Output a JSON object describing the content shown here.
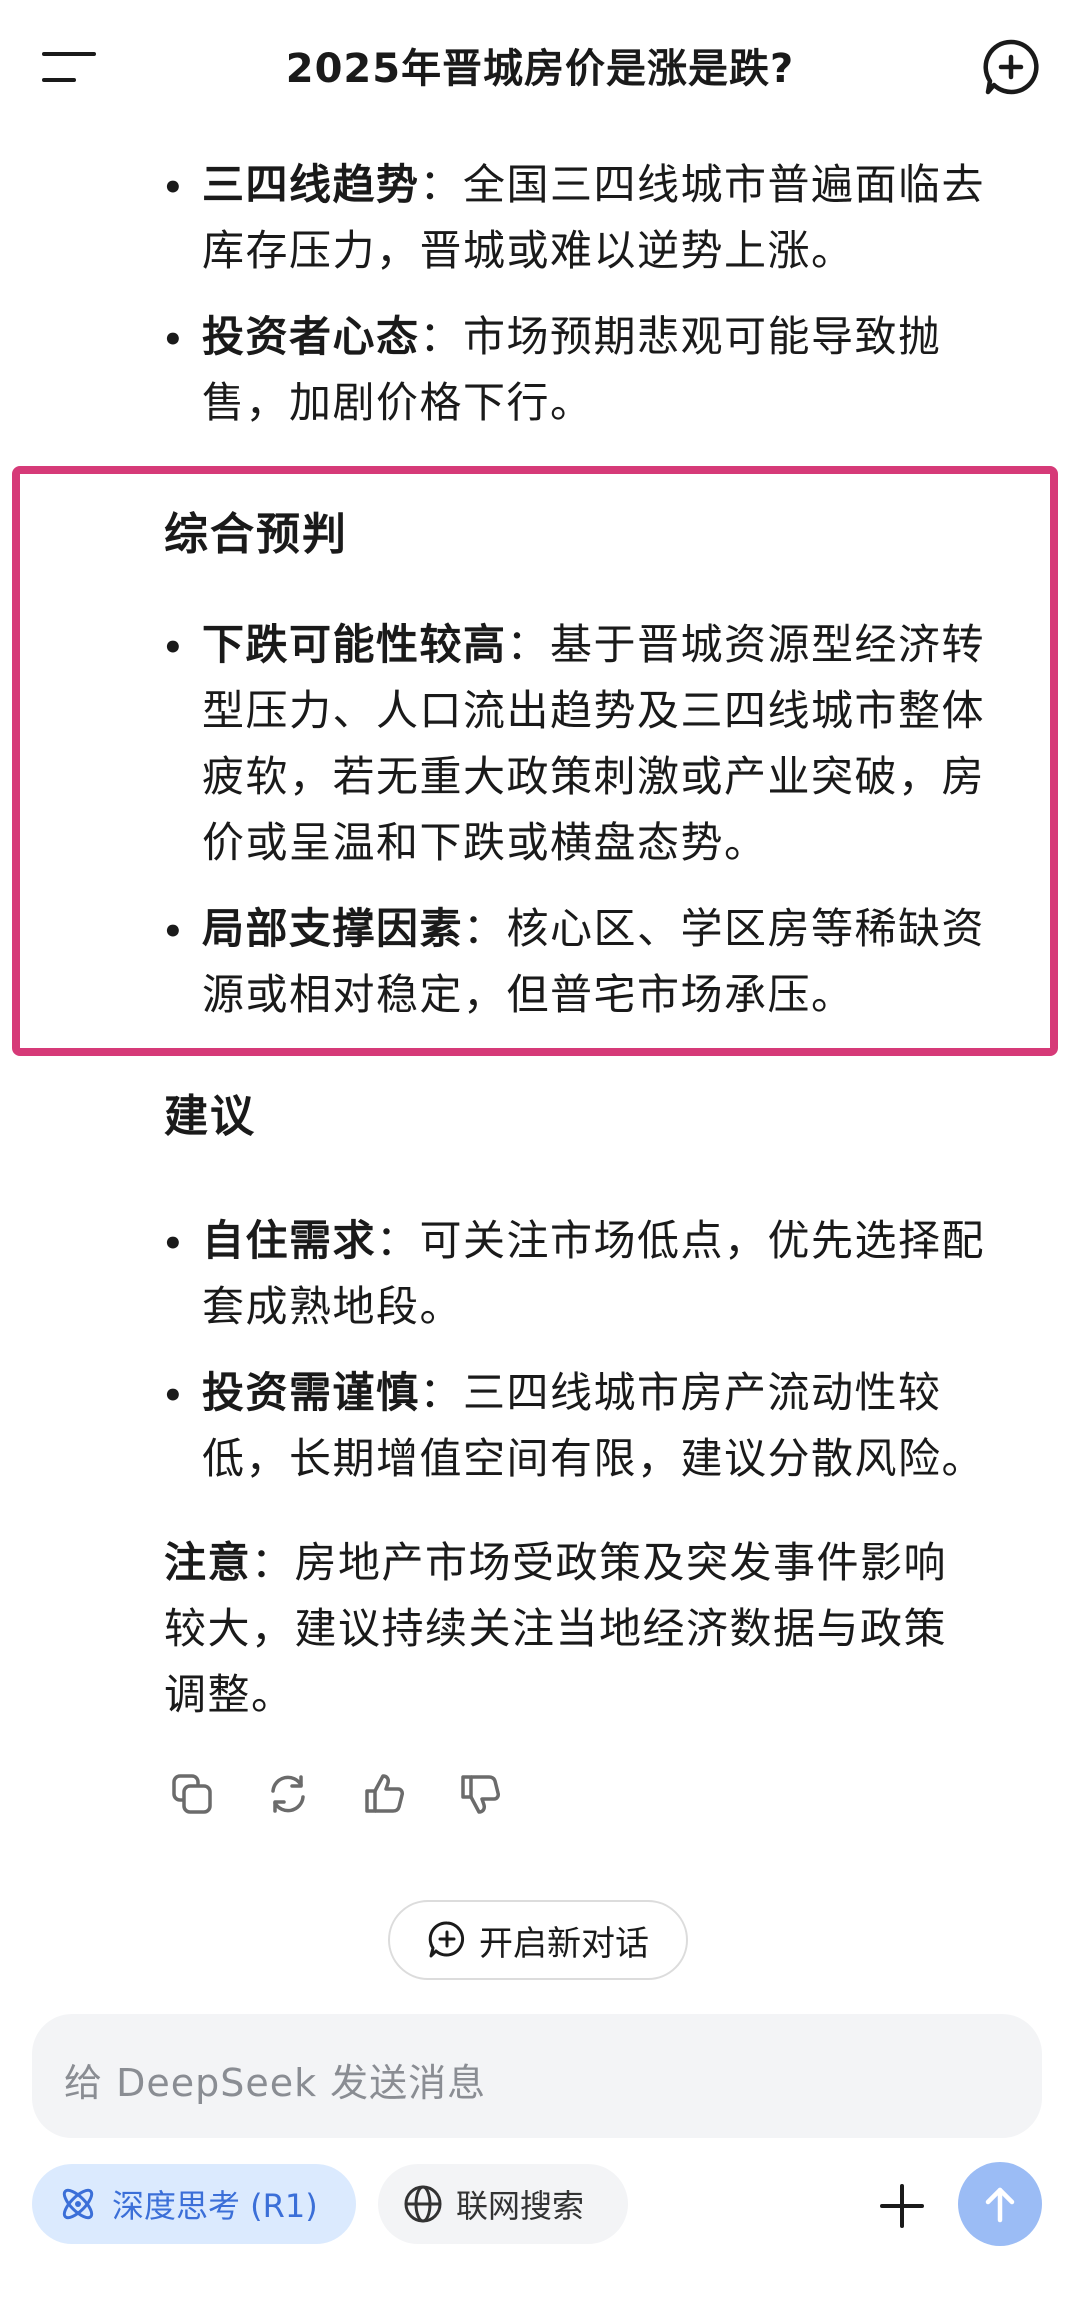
{
  "header": {
    "title": "2025年晋城房价是涨是跌?"
  },
  "sections": {
    "top": [
      {
        "term": "三四线趋势",
        "sep": ":",
        "text": "全国三四线城市普遍面临去库存压力，晋城或难以逆势上涨。",
        "lines": [
          "三四线趋势：全国三四线城市普遍面临去",
          "库存压力，晋城或难以逆势上涨。"
        ]
      },
      {
        "term": "投资者心态",
        "sep": ":",
        "text": "市场预期悲观可能导致抛售，加剧价格下行。",
        "lines": [
          "投资者心态：市场预期悲观可能导致抛",
          "售，加剧价格下行。"
        ]
      }
    ],
    "forecast": {
      "heading": "综合预判",
      "items": [
        {
          "term": "下跌可能性较高",
          "lines": [
            "：基于晋城资源型经济转",
            "型压力、人口流出趋势及三四线城市整体",
            "疲软，若无重大政策刺激或产业突破，房",
            "价或呈温和下跌或横盘态势。"
          ]
        },
        {
          "term": "局部支撑因素",
          "lines": [
            "：核心区、学区房等稀缺资",
            "源或相对稳定，但普宅市场承压。"
          ]
        }
      ]
    },
    "advice": {
      "heading": "建议",
      "items": [
        {
          "term": "自住需求",
          "lines": [
            "：可关注市场低点，优先选择配",
            "套成熟地段。"
          ]
        },
        {
          "term": "投资需谨慎",
          "lines": [
            "：三四线城市房产流动性较",
            "低，长期增值空间有限，建议分散风险。"
          ]
        }
      ]
    },
    "note": {
      "term": "注意",
      "lines": [
        "：房地产市场受政策及突发事件影响",
        "较大，建议持续关注当地经济数据与政策",
        "调整。"
      ]
    }
  },
  "actions": {
    "icons": [
      "copy-icon",
      "regenerate-icon",
      "thumbs-up-icon",
      "thumbs-down-icon"
    ]
  },
  "new_chat_label": "开启新对话",
  "composer": {
    "placeholder": "给 DeepSeek 发送消息",
    "deep_think_label": "深度思考 (R1)",
    "web_search_label": "联网搜索"
  },
  "colors": {
    "highlight_border": "#d63a78",
    "accent": "#3b6fd8",
    "send_button": "#9bbcf5"
  }
}
